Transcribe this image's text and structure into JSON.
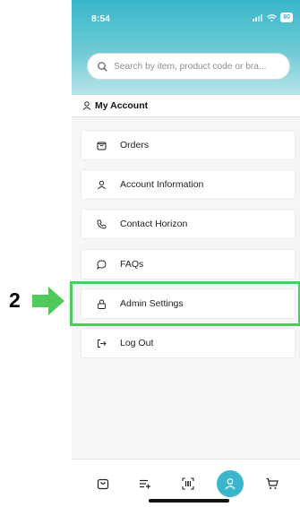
{
  "annotation": {
    "step_number": "2",
    "arrow_color": "#4ecb5a"
  },
  "status_bar": {
    "time": "8:54",
    "battery": "80"
  },
  "search": {
    "placeholder": "Search by item, product code or bra..."
  },
  "account": {
    "title": "My Account"
  },
  "menu": {
    "items": [
      {
        "label": "Orders",
        "icon": "shopping-bag-icon"
      },
      {
        "label": "Account Information",
        "icon": "user-icon"
      },
      {
        "label": "Contact Horizon",
        "icon": "phone-icon"
      },
      {
        "label": "FAQs",
        "icon": "chat-bubble-icon"
      },
      {
        "label": "Admin Settings",
        "icon": "lock-icon"
      },
      {
        "label": "Log Out",
        "icon": "logout-icon"
      }
    ]
  },
  "tabbar": {
    "tabs": [
      {
        "icon": "shopping-bag-icon"
      },
      {
        "icon": "list-add-icon"
      },
      {
        "icon": "barcode-scan-icon"
      },
      {
        "icon": "user-icon",
        "active": true
      },
      {
        "icon": "cart-icon"
      }
    ]
  },
  "colors": {
    "accent": "#39b6c9",
    "highlight": "#4ecb5a"
  }
}
